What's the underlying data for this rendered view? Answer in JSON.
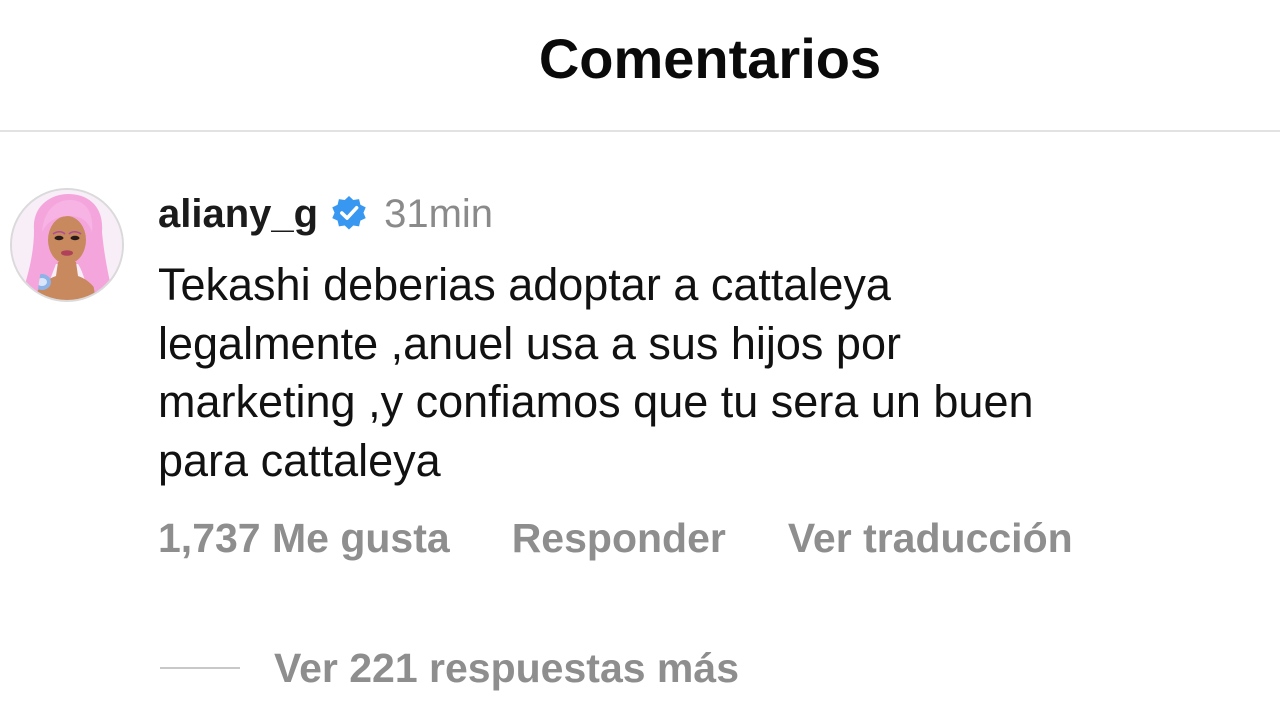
{
  "header": {
    "title": "Comentarios"
  },
  "comment": {
    "username": "aliany_g",
    "verified_icon": "verified-badge-icon",
    "verified_color": "#3897f0",
    "time": "31min",
    "text_lines": [
      "Tekashi deberias adoptar a cattaleya",
      "legalmente ,anuel usa a sus hijos por",
      "marketing ,y confiamos que tu sera un buen",
      "para cattaleya"
    ],
    "likes": "1,737 Me gusta",
    "reply_label": "Responder",
    "translate_label": "Ver traducción",
    "view_replies": "Ver 221 respuestas más"
  },
  "colors": {
    "secondary_text": "#8e8e8e",
    "divider": "#e2e2e2"
  }
}
